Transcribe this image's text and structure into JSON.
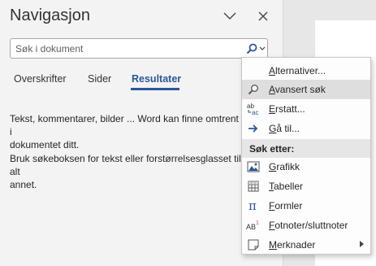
{
  "pane": {
    "title": "Navigasjon",
    "search_placeholder": "Søk i dokument"
  },
  "tabs": [
    {
      "label": "Overskrifter",
      "active": false
    },
    {
      "label": "Sider",
      "active": false
    },
    {
      "label": "Resultater",
      "active": true
    }
  ],
  "messages": {
    "m1": "Tekst, kommentarer, bilder ... Word kan finne omtrent alt i\ndokumentet ditt.",
    "m2": "Bruk søkeboksen for tekst eller forstørrelsesglasset til alt\nannet."
  },
  "menu": {
    "items_top": [
      {
        "pre": "",
        "u": "A",
        "post": "lternativer...",
        "icon": "none"
      },
      {
        "pre": "",
        "u": "A",
        "post": "vansert søk",
        "icon": "search-icon"
      },
      {
        "pre": "",
        "u": "E",
        "post": "rstatt...",
        "icon": "replace-icon"
      },
      {
        "pre": "",
        "u": "G",
        "post": "å til...",
        "icon": "arrow-right-icon"
      }
    ],
    "header": "Søk etter:",
    "items_bottom": [
      {
        "pre": "",
        "u": "G",
        "post": "rafikk",
        "icon": "graphics-icon"
      },
      {
        "pre": "",
        "u": "T",
        "post": "abeller",
        "icon": "table-icon"
      },
      {
        "pre": "",
        "u": "F",
        "post": "ormler",
        "icon": "pi-icon"
      },
      {
        "pre": "",
        "u": "F",
        "post": "otnoter/sluttnoter",
        "icon": "footnote-icon"
      },
      {
        "pre": "",
        "u": "M",
        "post": "erknader",
        "icon": "comment-icon"
      }
    ]
  },
  "colors": {
    "accent": "#2b579a",
    "highlight": "#dedede"
  }
}
